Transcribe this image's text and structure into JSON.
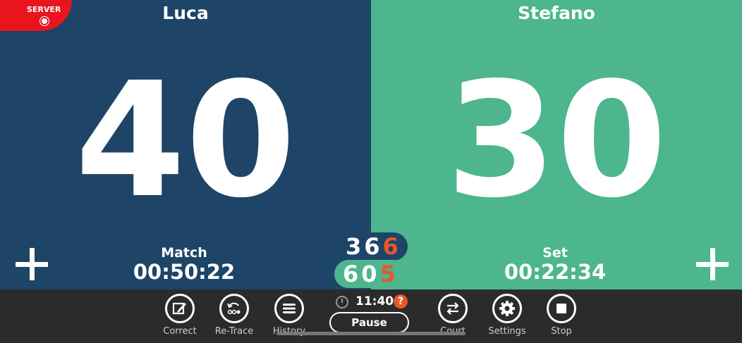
{
  "server_badge": {
    "label": "SERVER"
  },
  "players": {
    "left": {
      "name": "Luca",
      "score": "40",
      "timer_label": "Match",
      "timer_value": "00:50:22",
      "color": "#1e4467"
    },
    "right": {
      "name": "Stefano",
      "score": "30",
      "timer_label": "Set",
      "timer_value": "00:22:34",
      "color": "#4db68e"
    }
  },
  "sets": {
    "top": [
      "3",
      "6",
      "6"
    ],
    "bottom": [
      "6",
      "0",
      "5"
    ],
    "current_color": "#e8572a"
  },
  "clock": {
    "time": "11:40",
    "help": "?"
  },
  "pause": {
    "label": "Pause"
  },
  "toolbar": {
    "correct": "Correct",
    "retrace": "Re-Trace",
    "history": "History",
    "court": "Court",
    "settings": "Settings",
    "stop": "Stop"
  },
  "icons": [
    "edit-icon",
    "retrace-icon",
    "menu-icon",
    "swap-icon",
    "gear-icon",
    "stop-icon",
    "clock-icon",
    "help-icon",
    "plus-icon",
    "tennis-ball-icon"
  ]
}
